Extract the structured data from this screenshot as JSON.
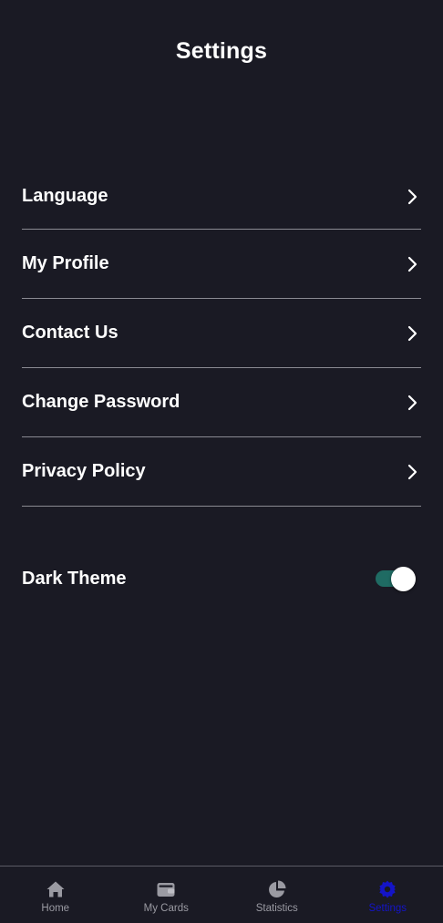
{
  "header": {
    "title": "Settings"
  },
  "menu": {
    "items": [
      {
        "label": "Language"
      },
      {
        "label": "My Profile"
      },
      {
        "label": "Contact Us"
      },
      {
        "label": "Change Password"
      },
      {
        "label": "Privacy Policy"
      }
    ]
  },
  "theme": {
    "label": "Dark Theme",
    "enabled": true
  },
  "bottom_nav": {
    "items": [
      {
        "label": "Home",
        "icon": "home-icon"
      },
      {
        "label": "My Cards",
        "icon": "wallet-icon"
      },
      {
        "label": "Statistics",
        "icon": "pie-chart-icon"
      },
      {
        "label": "Settings",
        "icon": "gear-icon",
        "active": true
      }
    ]
  },
  "colors": {
    "background": "#1a1a24",
    "toggle_track": "#1f6b63",
    "nav_inactive": "#9a9aa2",
    "nav_active": "#1414c8"
  }
}
